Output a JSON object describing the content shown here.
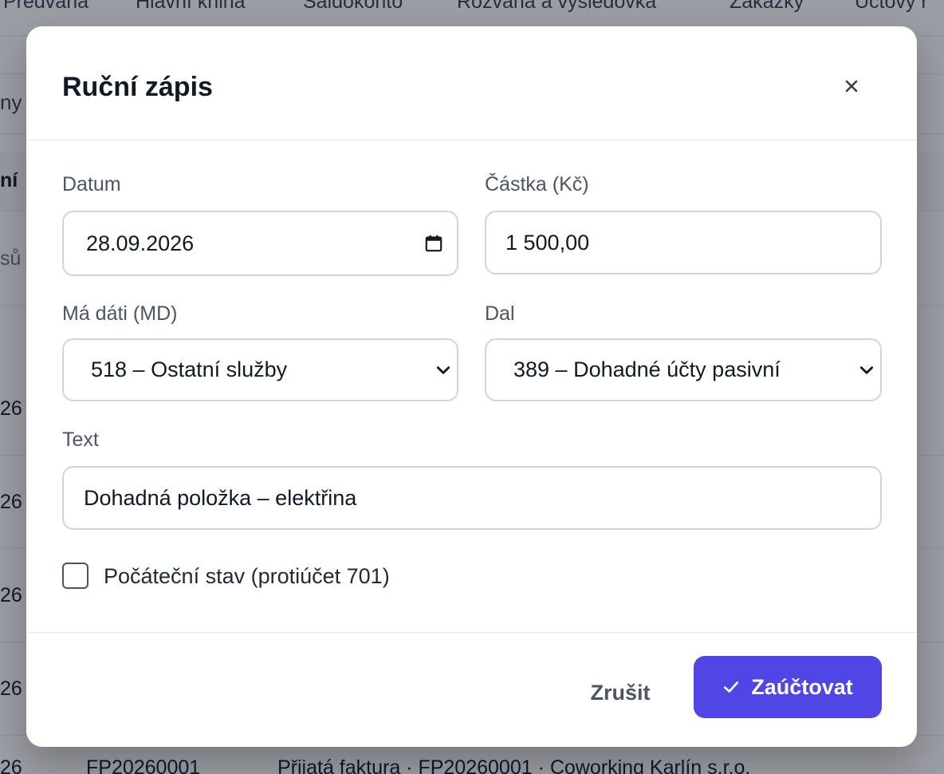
{
  "background": {
    "nav_tabs": [
      "Předvaha",
      "Hlavní kniha",
      "Saldokonto",
      "Rozvaha a výsledovka",
      "Zakázky",
      "Účtový r"
    ],
    "filter_fragment": "ny",
    "header_fragment": "ní",
    "subheader_fragment": "sů ·",
    "row_fragments": [
      "26",
      "26",
      "26",
      "26"
    ],
    "bottom_row": {
      "date_fragment": "26",
      "doc": "FP20260001",
      "text": "Přijatá faktura · FP20260001 · Coworking Karlín s.r.o."
    }
  },
  "modal": {
    "title": "Ruční zápis",
    "close_label": "×",
    "fields": {
      "date": {
        "label": "Datum",
        "value": "28.09.2026"
      },
      "amount": {
        "label": "Částka (Kč)",
        "value": "1 500,00"
      },
      "debit": {
        "label": "Má dáti (MD)",
        "value": "518 – Ostatní služby"
      },
      "credit": {
        "label": "Dal",
        "value": "389 – Dohadné účty pasivní"
      },
      "text": {
        "label": "Text",
        "value": "Dohadná položka – elektřina"
      }
    },
    "opening_balance": {
      "label": "Počáteční stav (protiúčet 701)",
      "checked": false
    },
    "buttons": {
      "cancel": "Zrušit",
      "submit": "Zaúčtovat"
    }
  },
  "colors": {
    "primary": "#4f46e5",
    "border": "#d1d5db",
    "label": "#4b5563"
  }
}
